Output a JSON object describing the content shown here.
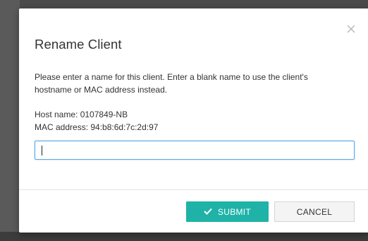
{
  "dialog": {
    "title": "Rename Client",
    "description": "Please enter a name for this client. Enter a blank name to use the client's hostname or MAC address instead.",
    "host_name": "Host name: 0107849-NB",
    "mac_address": "MAC address: 94:b8:6d:7c:2d:97",
    "name_input_value": "",
    "submit_label": "SUBMIT",
    "cancel_label": "CANCEL",
    "close_icon": "close-icon",
    "submit_icon": "checkmark-icon"
  },
  "colors": {
    "accent": "#1fb3a8",
    "input_focus_border": "#5aa8e6",
    "overlay": "#4a4a4a"
  }
}
